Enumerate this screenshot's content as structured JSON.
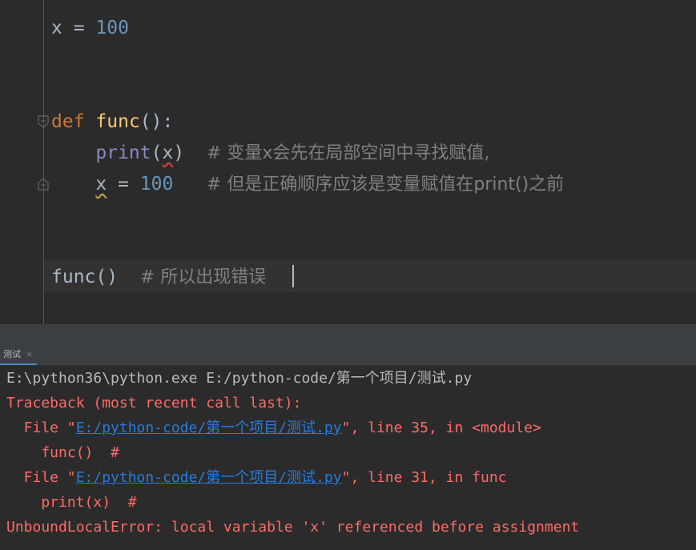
{
  "editor": {
    "line1": {
      "var": "x",
      "op": " = ",
      "num": "100"
    },
    "def_kw": "def",
    "func_name": "func",
    "func_sig": "():",
    "print_builtin": "print",
    "print_open": "(",
    "print_arg": "x",
    "print_close": ")",
    "comment1": "# 变量x会先在局部空间中寻找赋值,",
    "assign_var": "x",
    "assign_op": " = ",
    "assign_num": "100",
    "comment2": "# 但是正确顺序应该是变量赋值在print()之前",
    "call": "func()",
    "comment3": "# 所以出现错误"
  },
  "run_panel": {
    "tab_label": "测试",
    "tab_close": "×",
    "console": {
      "cmd": "E:\\python36\\python.exe E:/python-code/第一个项目/测试.py",
      "traceback_header": "Traceback (most recent call last):",
      "frame1_prefix": "  File \"",
      "frame1_path": "E:/python-code/第一个项目/测试.py",
      "frame1_suffix": "\", line 35, in <module>",
      "frame1_code": "    func()  #",
      "frame2_prefix": "  File \"",
      "frame2_path": "E:/python-code/第一个项目/测试.py",
      "frame2_suffix": "\", line 31, in func",
      "frame2_code": "    print(x)  #",
      "error": "UnboundLocalError: local variable 'x' referenced before assignment"
    }
  },
  "colors": {
    "editor_bg": "#2b2b2b",
    "keyword": "#cc7832",
    "number": "#6897bb",
    "function": "#ffc66d",
    "builtin": "#8888c6",
    "comment": "#808080",
    "error_text": "#ff6b68",
    "link": "#287bde"
  }
}
